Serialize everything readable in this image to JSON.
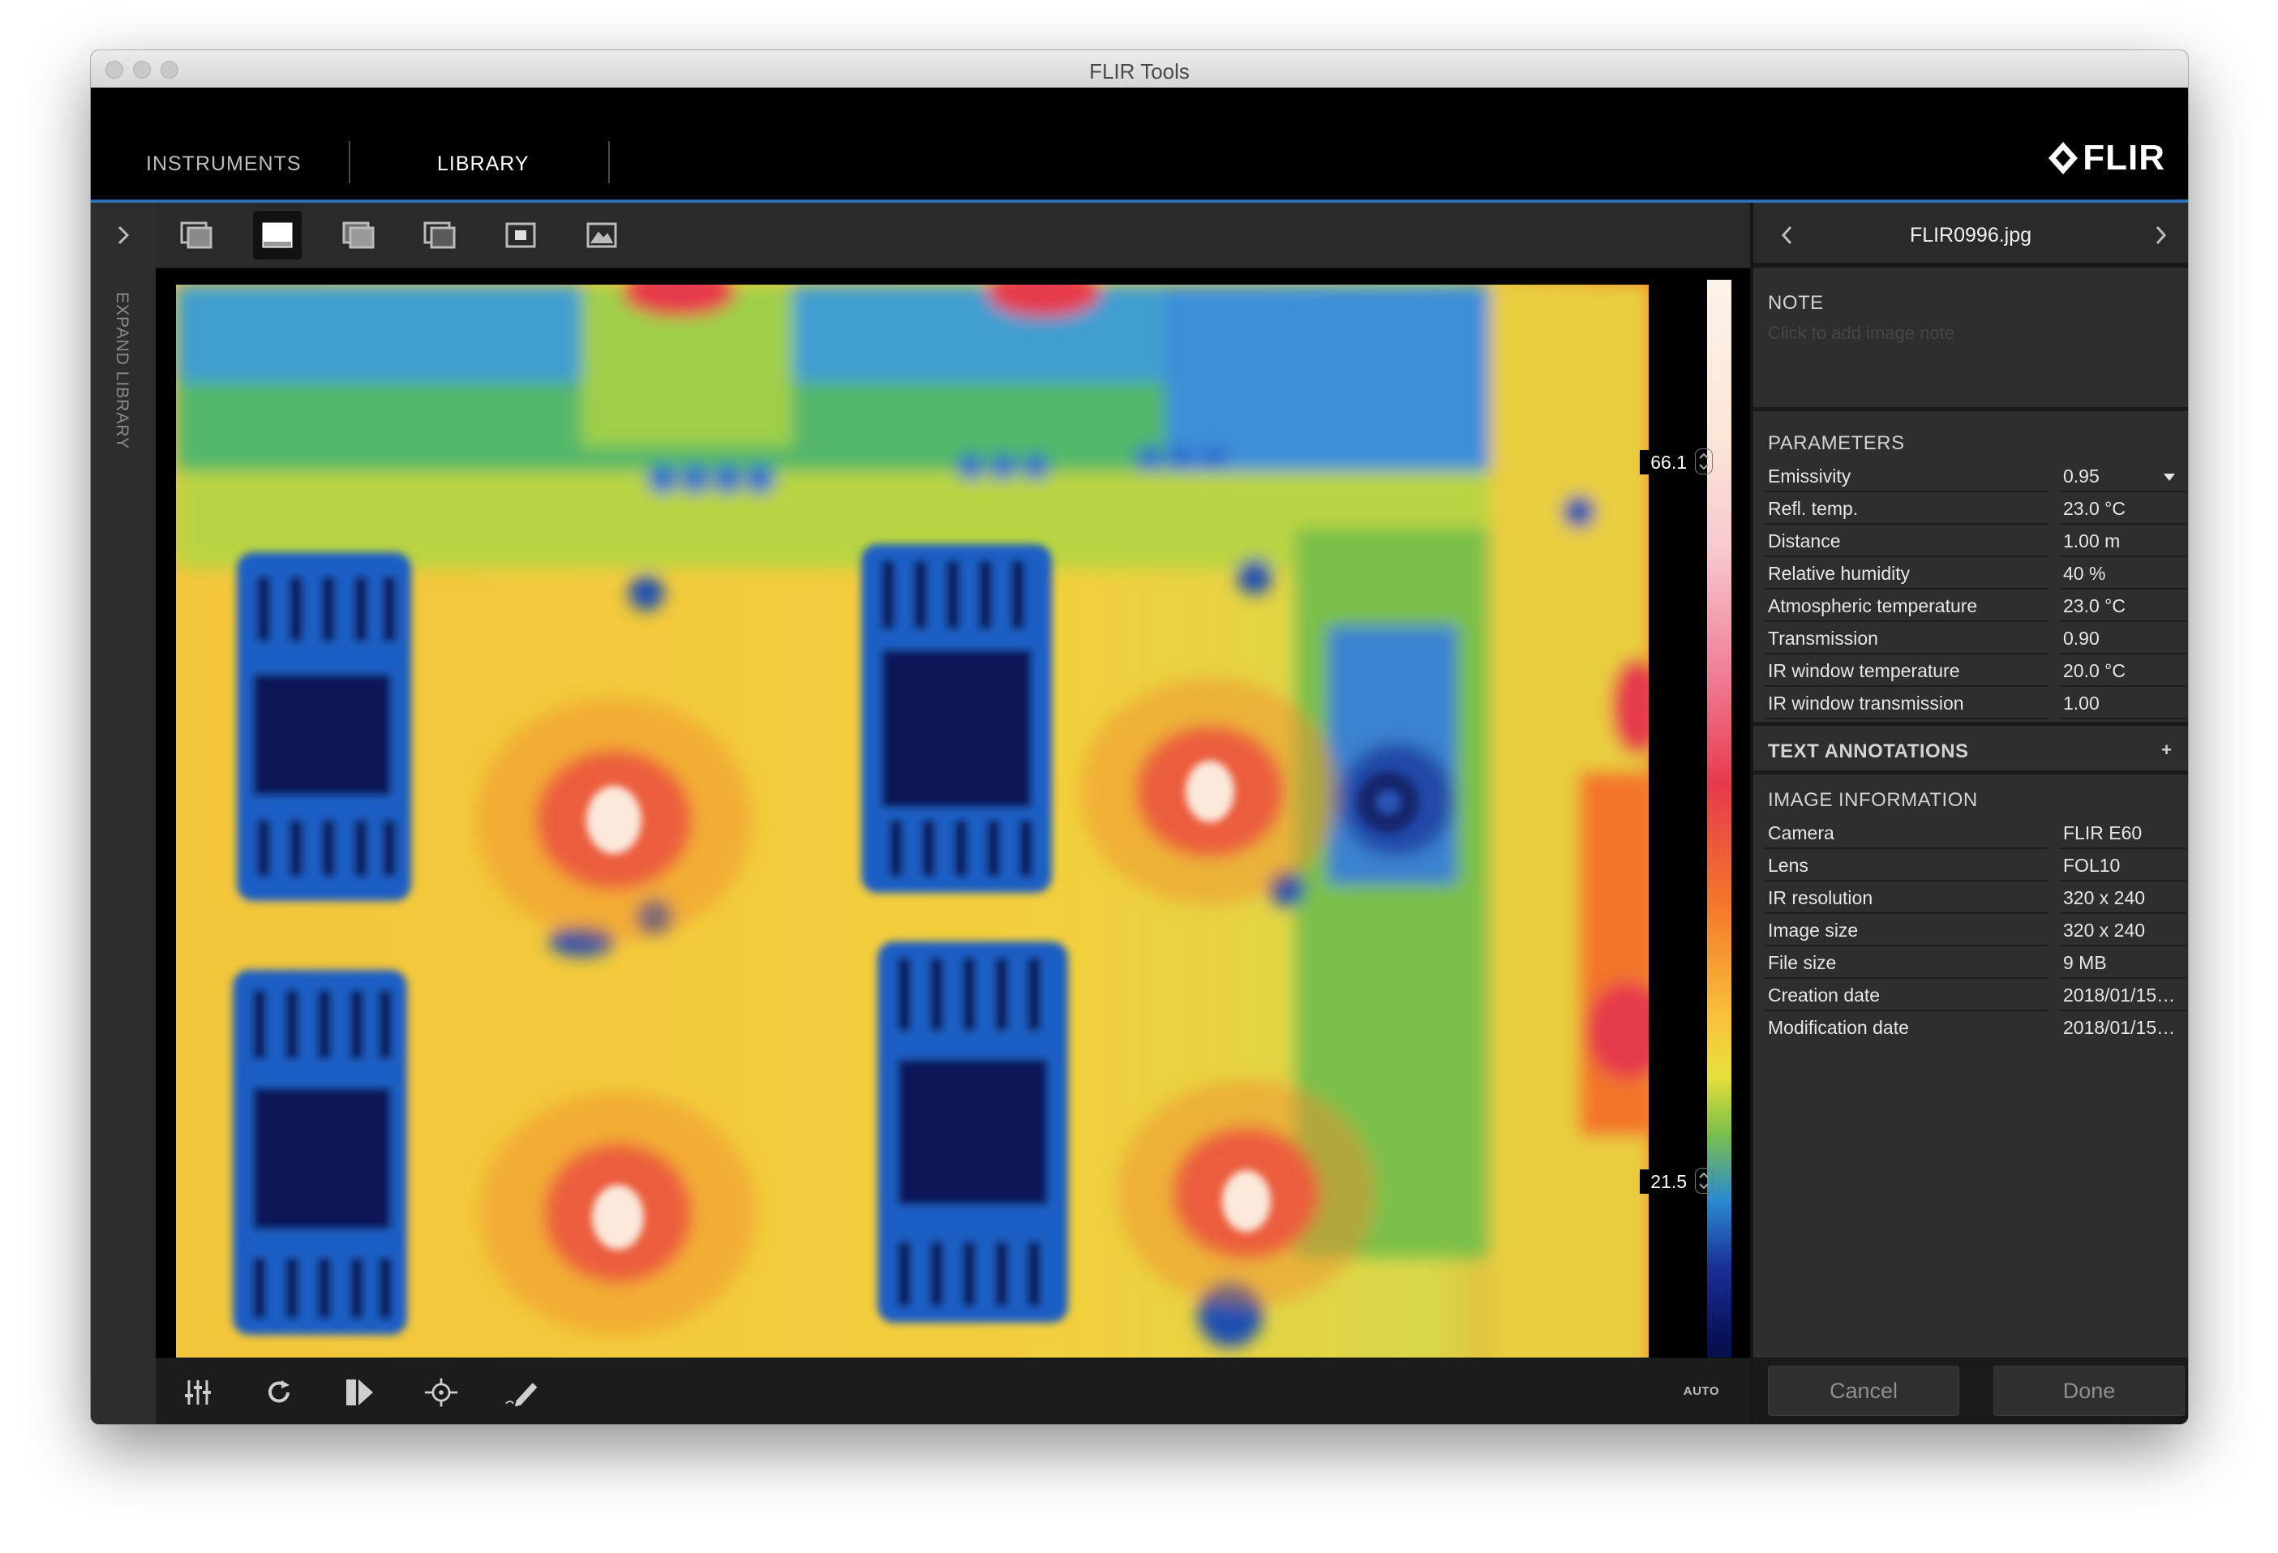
{
  "window": {
    "title": "FLIR Tools"
  },
  "nav": {
    "tabs": [
      {
        "label": "INSTRUMENTS",
        "active": false
      },
      {
        "label": "LIBRARY",
        "active": true
      }
    ],
    "logo": "FLIR"
  },
  "library": {
    "expand_label": "EXPAND LIBRARY"
  },
  "toolbar": {
    "icons": [
      "fusion-picture-in-picture-icon",
      "ir-image-icon",
      "thermal-msx-icon",
      "thermal-blending-icon",
      "picture-in-picture-icon",
      "digital-photo-icon"
    ],
    "active_index": 1
  },
  "scale": {
    "max": "66.1",
    "min": "21.5",
    "palette": "rainbow-hc"
  },
  "bottom_toolbar": {
    "auto_label": "AUTO",
    "icons": [
      "adjust-sliders-icon",
      "rotate-icon",
      "palette-icon",
      "measurement-tool-icon",
      "annotate-pen-icon"
    ]
  },
  "file": {
    "name": "FLIR0996.jpg"
  },
  "note": {
    "title": "NOTE",
    "placeholder": "Click to add image note"
  },
  "parameters": {
    "title": "PARAMETERS",
    "rows": [
      {
        "label": "Emissivity",
        "value": "0.95"
      },
      {
        "label": "Refl. temp.",
        "value": "23.0 °C"
      },
      {
        "label": "Distance",
        "value": "1.00 m"
      },
      {
        "label": "Relative humidity",
        "value": "40 %"
      },
      {
        "label": "Atmospheric temperature",
        "value": "23.0 °C"
      },
      {
        "label": "Transmission",
        "value": "0.90"
      },
      {
        "label": "IR window temperature",
        "value": "20.0 °C"
      },
      {
        "label": "IR window transmission",
        "value": "1.00"
      }
    ]
  },
  "text_annotations": {
    "title": "TEXT ANNOTATIONS",
    "add": "+"
  },
  "image_information": {
    "title": "IMAGE INFORMATION",
    "rows": [
      {
        "label": "Camera",
        "value": "FLIR E60"
      },
      {
        "label": "Lens",
        "value": "FOL10"
      },
      {
        "label": "IR resolution",
        "value": "320 x 240"
      },
      {
        "label": "Image size",
        "value": "320 x 240"
      },
      {
        "label": "File size",
        "value": "9 MB"
      },
      {
        "label": "Creation date",
        "value": "2018/01/15…"
      },
      {
        "label": "Modification date",
        "value": "2018/01/15…"
      }
    ]
  },
  "footer": {
    "cancel": "Cancel",
    "done": "Done"
  },
  "colors": {
    "accent": "#2f6fb8",
    "panel_bg": "#2e2e2e",
    "toolbar_bg": "#2a2a2a"
  }
}
